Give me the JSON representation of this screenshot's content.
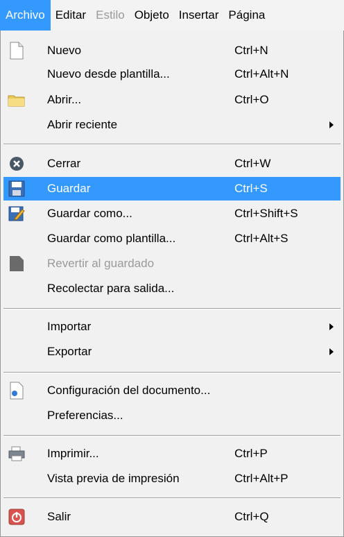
{
  "menubar": {
    "items": [
      {
        "label": "Archivo"
      },
      {
        "label": "Editar"
      },
      {
        "label": "Estilo"
      },
      {
        "label": "Objeto"
      },
      {
        "label": "Insertar"
      },
      {
        "label": "Página"
      }
    ]
  },
  "menu": {
    "items": [
      {
        "label": "Nuevo",
        "shortcut": "Ctrl+N",
        "icon": "new-document-icon"
      },
      {
        "label": "Nuevo desde plantilla...",
        "shortcut": "Ctrl+Alt+N"
      },
      {
        "label": "Abrir...",
        "shortcut": "Ctrl+O",
        "icon": "folder-icon"
      },
      {
        "label": "Abrir reciente",
        "shortcut": "",
        "submenu": true
      },
      {
        "label": "Cerrar",
        "shortcut": "Ctrl+W",
        "icon": "close-circle-icon"
      },
      {
        "label": "Guardar",
        "shortcut": "Ctrl+S",
        "icon": "save-disk-icon",
        "highlighted": true
      },
      {
        "label": "Guardar como...",
        "shortcut": "Ctrl+Shift+S",
        "icon": "save-as-icon"
      },
      {
        "label": "Guardar como plantilla...",
        "shortcut": "Ctrl+Alt+S"
      },
      {
        "label": "Revertir al guardado",
        "shortcut": "",
        "icon": "revert-icon",
        "disabled": true
      },
      {
        "label": "Recolectar para salida...",
        "shortcut": ""
      },
      {
        "label": "Importar",
        "shortcut": "",
        "submenu": true
      },
      {
        "label": "Exportar",
        "shortcut": "",
        "submenu": true
      },
      {
        "label": "Configuración del documento...",
        "shortcut": "",
        "icon": "document-setup-icon"
      },
      {
        "label": "Preferencias...",
        "shortcut": ""
      },
      {
        "label": "Imprimir...",
        "shortcut": "Ctrl+P",
        "icon": "printer-icon"
      },
      {
        "label": "Vista previa de impresión",
        "shortcut": "Ctrl+Alt+P"
      },
      {
        "label": "Salir",
        "shortcut": "Ctrl+Q",
        "icon": "power-icon"
      }
    ]
  },
  "colors": {
    "highlight": "#3399ff",
    "menu_background": "#f1f1f1",
    "disabled_text": "#9a9a9a"
  }
}
